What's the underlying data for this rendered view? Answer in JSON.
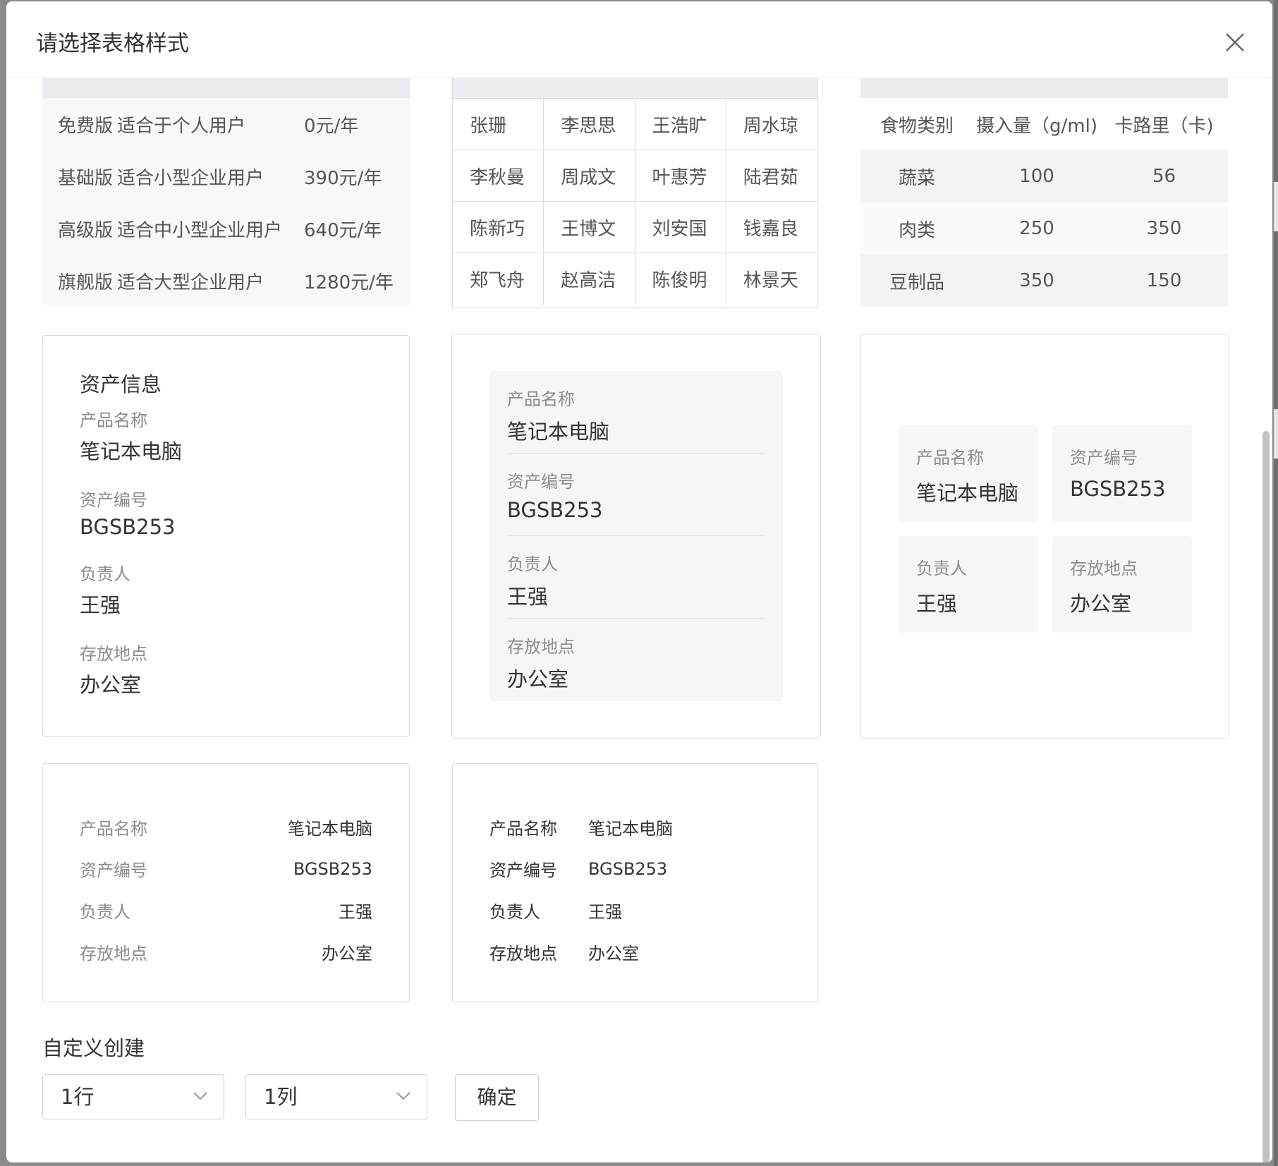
{
  "dialog": {
    "title": "请选择表格样式"
  },
  "table_pricing": {
    "rows": [
      {
        "name": "免费版",
        "desc": "适合于个人用户",
        "price": "0元/年"
      },
      {
        "name": "基础版",
        "desc": "适合小型企业用户",
        "price": "390元/年"
      },
      {
        "name": "高级版",
        "desc": "适合中小型企业用户",
        "price": "640元/年"
      },
      {
        "name": "旗舰版",
        "desc": "适合大型企业用户",
        "price": "1280元/年"
      }
    ]
  },
  "table_names": {
    "rows": [
      [
        "张珊",
        "李思思",
        "王浩旷",
        "周水琼"
      ],
      [
        "李秋曼",
        "周成文",
        "叶惠芳",
        "陆君茹"
      ],
      [
        "陈新巧",
        "王博文",
        "刘安国",
        "钱嘉良"
      ],
      [
        "郑飞舟",
        "赵高洁",
        "陈俊明",
        "林景天"
      ]
    ]
  },
  "table_food": {
    "headers": [
      "食物类别",
      "摄入量（g/ml)",
      "卡路里（卡)"
    ],
    "rows": [
      [
        "蔬菜",
        "100",
        "56"
      ],
      [
        "肉类",
        "250",
        "350"
      ],
      [
        "豆制品",
        "350",
        "150"
      ]
    ]
  },
  "asset": {
    "section_title": "资产信息",
    "fields": [
      {
        "label": "产品名称",
        "value": "笔记本电脑"
      },
      {
        "label": "资产编号",
        "value": "BGSB253"
      },
      {
        "label": "负责人",
        "value": "王强"
      },
      {
        "label": "存放地点",
        "value": "办公室"
      }
    ]
  },
  "custom": {
    "title": "自定义创建",
    "rows_select": "1行",
    "cols_select": "1列",
    "confirm_label": "确定"
  }
}
